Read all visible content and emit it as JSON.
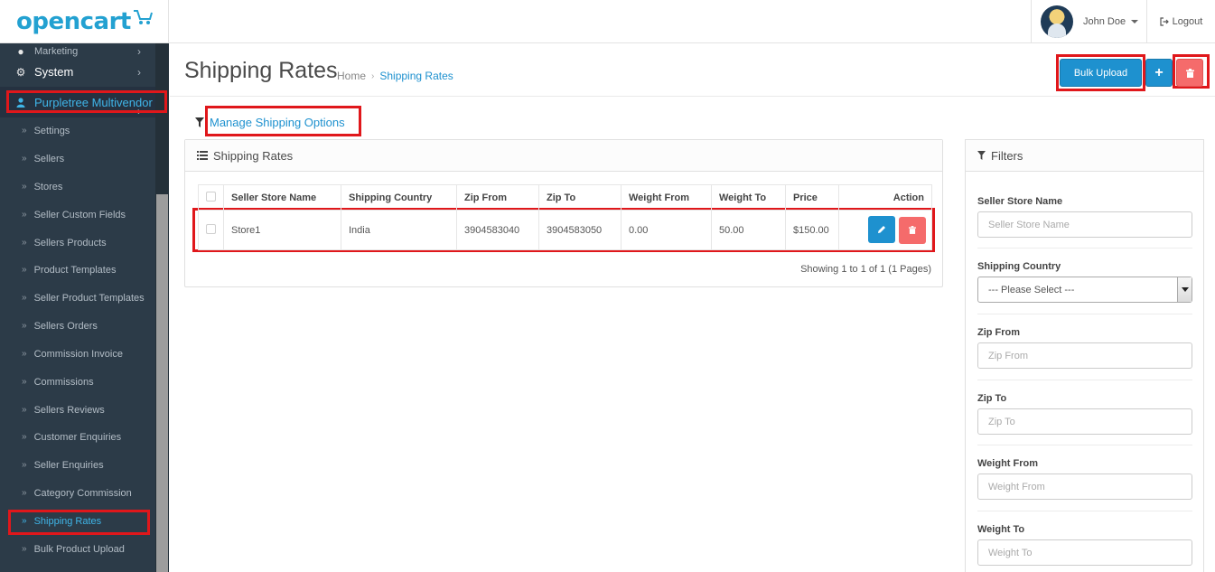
{
  "header": {
    "logo_text": "opencart",
    "user_name": "John Doe",
    "logout_label": "Logout"
  },
  "sidebar": {
    "marketing": "Marketing",
    "system": "System",
    "purpletree": "Purpletree Multivendor",
    "items": [
      "Settings",
      "Sellers",
      "Stores",
      "Seller Custom Fields",
      "Sellers Products",
      "Product Templates",
      "Seller Product Templates",
      "Sellers Orders",
      "Commission Invoice",
      "Commissions",
      "Sellers Reviews",
      "Customer Enquiries",
      "Seller Enquiries",
      "Category Commission",
      "Shipping Rates",
      "Bulk Product Upload"
    ]
  },
  "page": {
    "title": "Shipping Rates",
    "breadcrumb_home": "Home",
    "breadcrumb_current": "Shipping Rates",
    "bulk_upload_label": "Bulk Upload",
    "add_label": "+",
    "manage_link": "Manage Shipping Options"
  },
  "rates_panel": {
    "title": "Shipping Rates",
    "columns": [
      "Seller Store Name",
      "Shipping Country",
      "Zip From",
      "Zip To",
      "Weight From",
      "Weight To",
      "Price",
      "Action"
    ],
    "rows": [
      {
        "store": "Store1",
        "country": "India",
        "zip_from": "3904583040",
        "zip_to": "3904583050",
        "weight_from": "0.00",
        "weight_to": "50.00",
        "price": "$150.00"
      }
    ],
    "showing": "Showing 1 to 1 of 1 (1 Pages)"
  },
  "filters": {
    "title": "Filters",
    "store_label": "Seller Store Name",
    "store_placeholder": "Seller Store Name",
    "country_label": "Shipping Country",
    "country_selected": "--- Please Select ---",
    "zip_from_label": "Zip From",
    "zip_from_placeholder": "Zip From",
    "zip_to_label": "Zip To",
    "zip_to_placeholder": "Zip To",
    "weight_from_label": "Weight From",
    "weight_from_placeholder": "Weight From",
    "weight_to_label": "Weight To",
    "weight_to_placeholder": "Weight To"
  },
  "colors": {
    "primary": "#1e91cf",
    "danger": "#f56b6b",
    "sidebar_bg": "#2c3b48",
    "highlight_box": "#e0171b"
  }
}
